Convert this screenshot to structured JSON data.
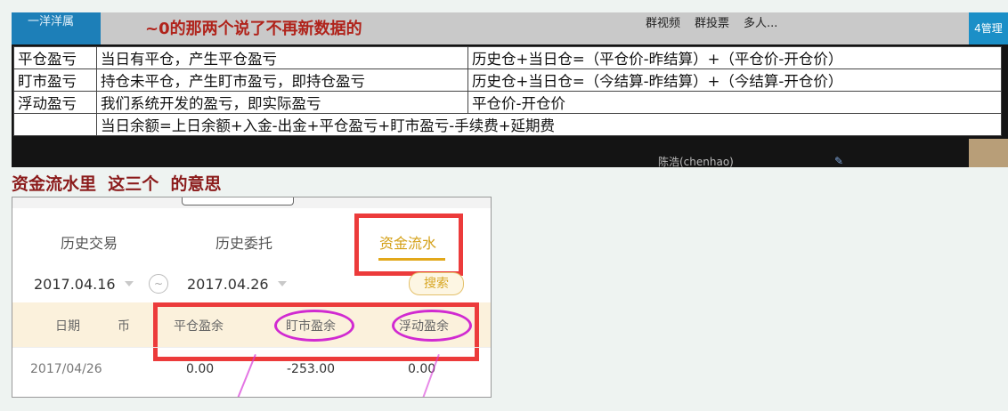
{
  "background_window": {
    "left_tab": "一洋洋属",
    "title_partial": "~0的那两个说了不再新数据的",
    "menu": [
      "群视频",
      "群投票",
      "多人..."
    ],
    "right_label": "4管理",
    "user_entry": "陈浩(chenhao)"
  },
  "pnl_table": {
    "rows": [
      {
        "term": "平仓盈亏",
        "meaning": "当日有平仓，产生平仓盈亏",
        "formula": "历史仓+当日仓=（平仓价-昨结算）+（平仓价-开仓价）"
      },
      {
        "term": "盯市盈亏",
        "meaning": "持仓未平仓，产生盯市盈亏，即持仓盈亏",
        "formula": "历史仓+当日仓=（今结算-昨结算）+（今结算-开仓价）"
      },
      {
        "term": "浮动盈亏",
        "meaning": "我们系统开发的盈亏，即实际盈亏",
        "formula": "平仓价-开仓价"
      },
      {
        "term": "",
        "meaning": "当日余额=上日余额+入金-出金+平仓盈亏+盯市盈亏-手续费+延期费",
        "formula": ""
      }
    ]
  },
  "caption": "资金流水里  这三个  的意思",
  "app": {
    "tabs": [
      "历史交易",
      "历史委托",
      "资金流水"
    ],
    "active_tab": "资金流水",
    "date_from": "2017.04.16",
    "date_to": "2017.04.26",
    "range_sep": "~",
    "search_label": "搜索",
    "columns": [
      "日期",
      "币",
      "平仓盈余",
      "盯市盈余",
      "浮动盈余"
    ],
    "row": {
      "date": "2017/04/26",
      "close_pnl": "0.00",
      "mtm_pnl": "-253.00",
      "float_pnl": "0.00"
    },
    "colors": {
      "accent": "#d4a017",
      "highlight_box": "#ec3b3b",
      "ellipse": "#d12ad1",
      "header_bg": "#fbf1dc"
    }
  }
}
